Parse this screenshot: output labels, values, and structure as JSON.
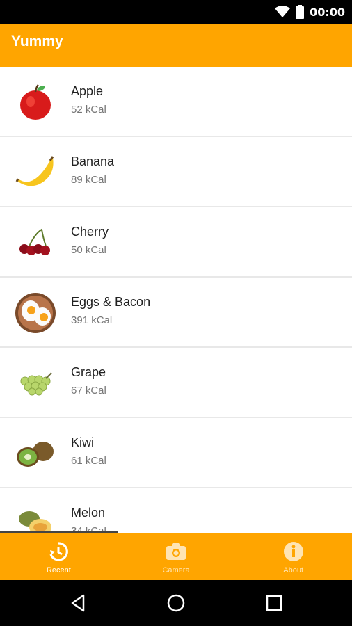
{
  "status": {
    "time": "00:00"
  },
  "app": {
    "title": "Yummy"
  },
  "items": [
    {
      "name": "Apple",
      "kcal": "52 kCal"
    },
    {
      "name": "Banana",
      "kcal": "89 kCal"
    },
    {
      "name": "Cherry",
      "kcal": "50 kCal"
    },
    {
      "name": "Eggs & Bacon",
      "kcal": "391 kCal"
    },
    {
      "name": "Grape",
      "kcal": "67 kCal"
    },
    {
      "name": "Kiwi",
      "kcal": "61 kCal"
    },
    {
      "name": "Melon",
      "kcal": "34 kCal"
    }
  ],
  "nav": [
    {
      "label": "Recent",
      "icon": "history-icon",
      "active": true
    },
    {
      "label": "Camera",
      "icon": "camera-icon",
      "active": false
    },
    {
      "label": "About",
      "icon": "info-icon",
      "active": false
    }
  ],
  "colors": {
    "accent": "#FFA500"
  }
}
